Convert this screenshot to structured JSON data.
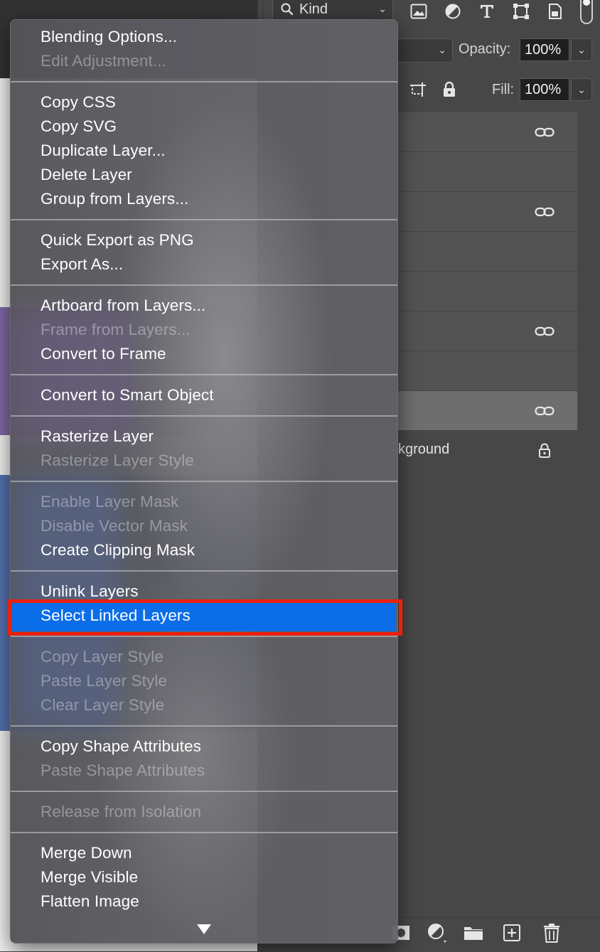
{
  "filter_bar": {
    "kind_label": "Kind"
  },
  "options": {
    "opacity_label": "Opacity:",
    "opacity_value": "100%",
    "fill_label": "Fill:",
    "fill_value": "100%"
  },
  "layers": [
    {
      "name": "",
      "icon": "link-icon"
    },
    {
      "name": "",
      "icon": ""
    },
    {
      "name": "",
      "icon": "link-icon"
    },
    {
      "name": "",
      "icon": ""
    },
    {
      "name": "",
      "icon": ""
    },
    {
      "name": "",
      "icon": "link-icon"
    },
    {
      "name": "",
      "icon": ""
    },
    {
      "name": "",
      "icon": "link-icon",
      "selected": true
    },
    {
      "name": "kground",
      "icon": "lock-icon"
    }
  ],
  "menu": {
    "items": [
      "Blending Options...",
      "Edit Adjustment...",
      "Copy CSS",
      "Copy SVG",
      "Duplicate Layer...",
      "Delete Layer",
      "Group from Layers...",
      "Quick Export as PNG",
      "Export As...",
      "Artboard from Layers...",
      "Frame from Layers...",
      "Convert to Frame",
      "Convert to Smart Object",
      "Rasterize Layer",
      "Rasterize Layer Style",
      "Enable Layer Mask",
      "Disable Vector Mask",
      "Create Clipping Mask",
      "Unlink Layers",
      "Select Linked Layers",
      "Copy Layer Style",
      "Paste Layer Style",
      "Clear Layer Style",
      "Copy Shape Attributes",
      "Paste Shape Attributes",
      "Release from Isolation",
      "Merge Down",
      "Merge Visible",
      "Flatten Image"
    ],
    "disabled": [
      "Edit Adjustment...",
      "Frame from Layers...",
      "Rasterize Layer Style",
      "Enable Layer Mask",
      "Disable Vector Mask",
      "Copy Layer Style",
      "Paste Layer Style",
      "Clear Layer Style",
      "Paste Shape Attributes",
      "Release from Isolation"
    ],
    "highlighted": "Select Linked Layers"
  },
  "colors": {
    "highlight": "#0b6ee8",
    "annotation_outline": "#e8210f",
    "panel_bg": "#474747"
  }
}
